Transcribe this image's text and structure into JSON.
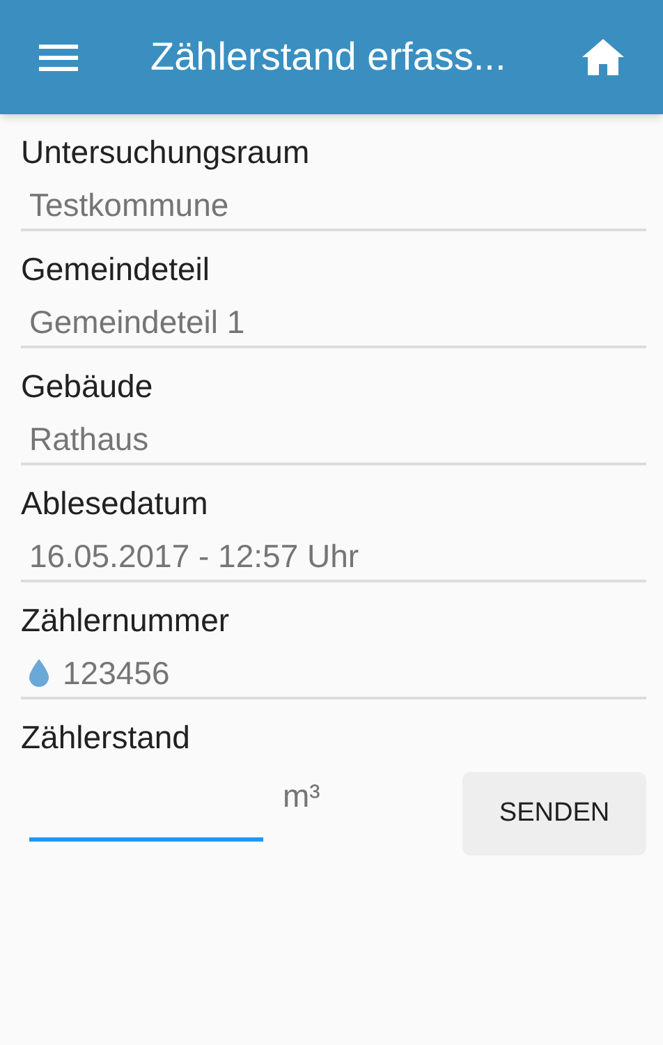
{
  "app_bar": {
    "title": "Zählerstand erfass..."
  },
  "fields": [
    {
      "label": "Untersuchungsraum",
      "value": "Testkommune",
      "kind": "text"
    },
    {
      "label": "Gemeindeteil",
      "value": "Gemeindeteil 1",
      "kind": "text"
    },
    {
      "label": "Gebäude",
      "value": "Rathaus",
      "kind": "text"
    },
    {
      "label": "Ablesedatum",
      "value": "16.05.2017 - 12:57 Uhr",
      "kind": "text"
    },
    {
      "label": "Zählernummer",
      "value": "123456",
      "kind": "water"
    }
  ],
  "reading": {
    "label": "Zählerstand",
    "focused": true,
    "unit": "m³",
    "button": "SENDEN"
  }
}
